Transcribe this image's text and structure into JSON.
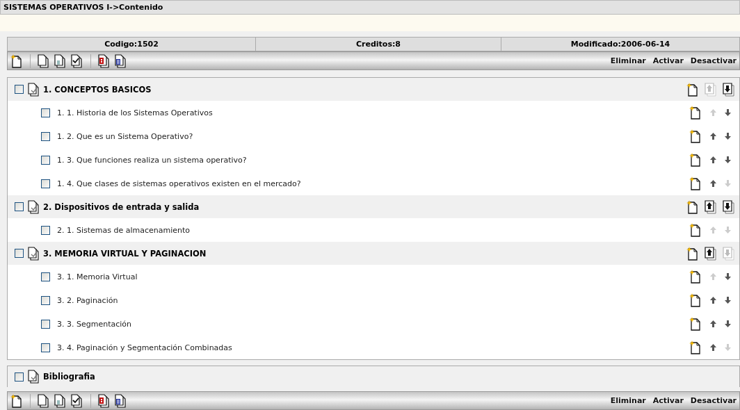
{
  "title": "SISTEMAS OPERATIVOS I->Contenido",
  "info": [
    "Codigo:1502",
    "Creditos:8",
    "Modificado:2006-06-14"
  ],
  "toolbar_actions": [
    "Eliminar",
    "Activar",
    "Desactivar"
  ],
  "sections": [
    {
      "title": "1. CONCEPTOS BASICOS",
      "checked": false,
      "up_enabled": false,
      "down_enabled": true,
      "items": [
        {
          "title": "1. 1. Historia de los Sistemas Operativos",
          "checked": false,
          "up_enabled": false,
          "down_enabled": true
        },
        {
          "title": "1. 2. Que es un Sistema Operativo?",
          "checked": false,
          "up_enabled": true,
          "down_enabled": true
        },
        {
          "title": "1. 3. Que funciones realiza un sistema operativo?",
          "checked": false,
          "up_enabled": true,
          "down_enabled": true
        },
        {
          "title": "1. 4. Que clases de sistemas operativos existen en el mercado?",
          "checked": false,
          "up_enabled": true,
          "down_enabled": false
        }
      ]
    },
    {
      "title": "2. Dispositivos de entrada y salida",
      "checked": false,
      "up_enabled": true,
      "down_enabled": true,
      "items": [
        {
          "title": "2. 1. Sistemas de almacenamiento",
          "checked": false,
          "up_enabled": false,
          "down_enabled": false
        }
      ]
    },
    {
      "title": "3. MEMORIA VIRTUAL Y PAGINACION",
      "checked": false,
      "up_enabled": true,
      "down_enabled": false,
      "items": [
        {
          "title": "3. 1. Memoria Virtual",
          "checked": false,
          "up_enabled": false,
          "down_enabled": true
        },
        {
          "title": "3. 2. Paginación",
          "checked": false,
          "up_enabled": true,
          "down_enabled": true
        },
        {
          "title": "3. 3. Segmentación",
          "checked": false,
          "up_enabled": true,
          "down_enabled": true
        },
        {
          "title": "3. 4. Paginación y Segmentación Combinadas",
          "checked": false,
          "up_enabled": true,
          "down_enabled": false
        }
      ]
    }
  ],
  "bibliography": {
    "title": "Bibliografia",
    "checked": false
  },
  "bottom_toolbar_actions": [
    "Eliminar",
    "Activar",
    "Desactivar"
  ]
}
